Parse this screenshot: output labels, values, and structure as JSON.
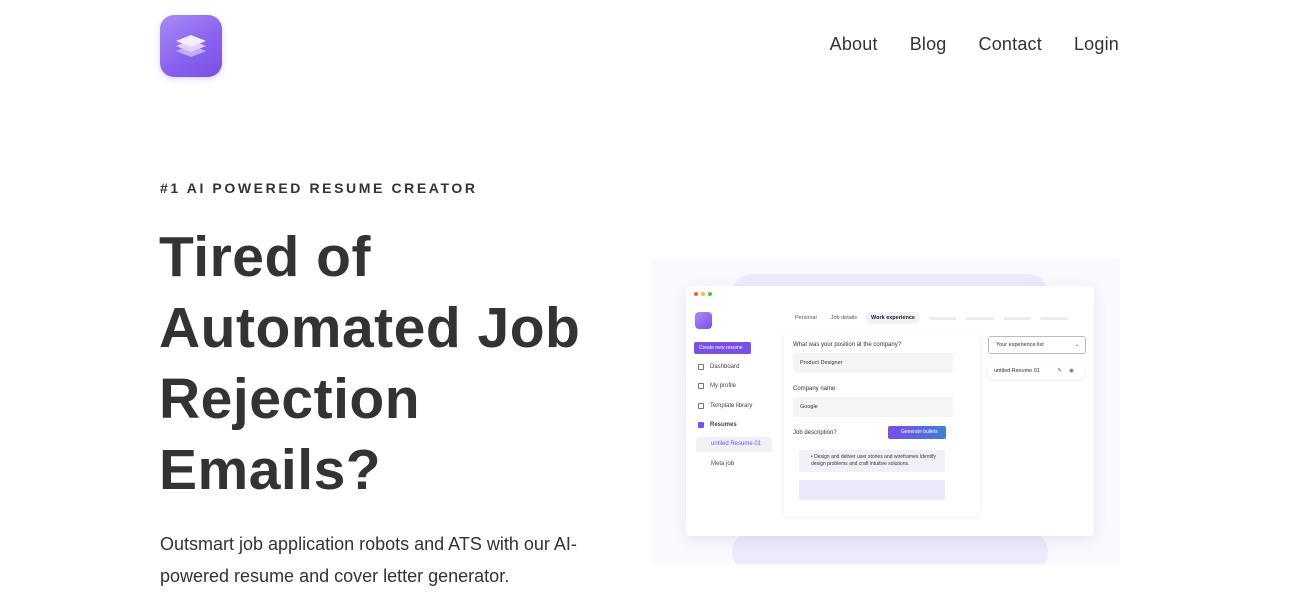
{
  "nav": {
    "items": [
      "About",
      "Blog",
      "Contact",
      "Login"
    ]
  },
  "hero": {
    "eyebrow": "#1 AI POWERED RESUME CREATOR",
    "headline": "Tired of Automated Job Rejection Emails?",
    "subtext": "Outsmart job application robots and ATS with our AI-powered resume and cover letter generator."
  },
  "preview": {
    "create_button": "Create new resume",
    "sidebar": [
      "Dashboard",
      "My profile",
      "Template library",
      "Resumes"
    ],
    "resume_items": [
      "untiled Resume 01",
      "Meta job"
    ],
    "tabs": [
      "Personal",
      "Job details",
      "Work experience"
    ],
    "position_label": "What was your position at the company?",
    "position_value": "Product Designer",
    "company_label": "Company name",
    "company_value": "Google",
    "job_desc_label": "Job description?",
    "generate_button": "Generate bullets",
    "bullet_text": "Design and deliver user stories and wireframes Identify design problems and craft intuitive solutions.",
    "experience_list_label": "Your experience list",
    "experience_item": "untiled Resume 01"
  },
  "colors": {
    "brand": "#7a4fe6",
    "text": "#333333"
  }
}
